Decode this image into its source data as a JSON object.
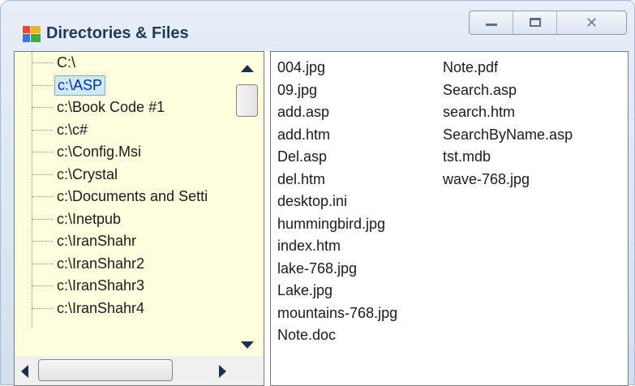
{
  "window": {
    "title": "Directories & Files"
  },
  "caption_buttons": {
    "minimize_icon": "minimize-icon",
    "maximize_icon": "maximize-icon",
    "close_glyph": "✕"
  },
  "tree": {
    "items": [
      {
        "label": "C:\\"
      },
      {
        "label": "c:\\ASP",
        "selected": true
      },
      {
        "label": "c:\\Book Code #1"
      },
      {
        "label": "c:\\c#"
      },
      {
        "label": "c:\\Config.Msi"
      },
      {
        "label": "c:\\Crystal"
      },
      {
        "label": "c:\\Documents and Setti"
      },
      {
        "label": "c:\\Inetpub"
      },
      {
        "label": "c:\\IranShahr"
      },
      {
        "label": "c:\\IranShahr2"
      },
      {
        "label": "c:\\IranShahr3"
      },
      {
        "label": "c:\\IranShahr4"
      }
    ],
    "background": "#ffffe0",
    "selected_color": "#003399"
  },
  "files": {
    "column1": [
      "004.jpg",
      "09.jpg",
      "add.asp",
      "add.htm",
      "Del.asp",
      "del.htm",
      "desktop.ini",
      "hummingbird.jpg",
      "index.htm",
      "lake-768.jpg",
      "Lake.jpg",
      "mountains-768.jpg",
      "Note.doc"
    ],
    "column2": [
      "Note.pdf",
      "Search.asp",
      "search.htm",
      "SearchByName.asp",
      "tst.mdb",
      "wave-768.jpg"
    ]
  }
}
